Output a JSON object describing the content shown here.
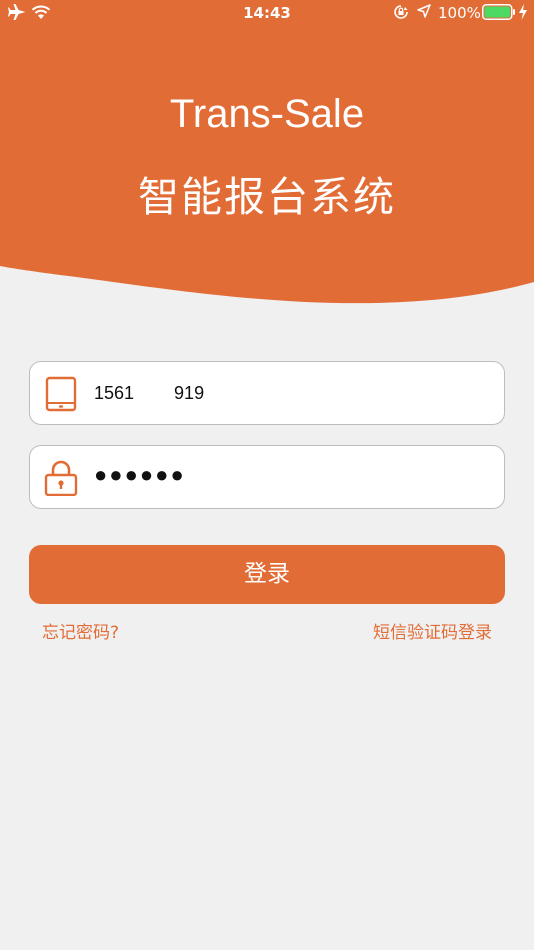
{
  "colors": {
    "accent": "#e26c36",
    "background": "#f0f0f0",
    "field_border": "#bdbdbd"
  },
  "status_bar": {
    "time": "14:43",
    "battery_percent": "100%",
    "icons": [
      "airplane-icon",
      "wifi-icon",
      "orientation-lock-icon",
      "location-icon",
      "battery-icon",
      "charging-icon"
    ]
  },
  "header": {
    "title": "Trans-Sale",
    "subtitle": "智能报台系统"
  },
  "form": {
    "phone": {
      "icon": "tablet-icon",
      "value": "1561        919"
    },
    "password": {
      "icon": "lock-icon",
      "value": "●●●●●●"
    },
    "login_label": "登录"
  },
  "links": {
    "forgot_password": "忘记密码?",
    "sms_login": "短信验证码登录"
  }
}
